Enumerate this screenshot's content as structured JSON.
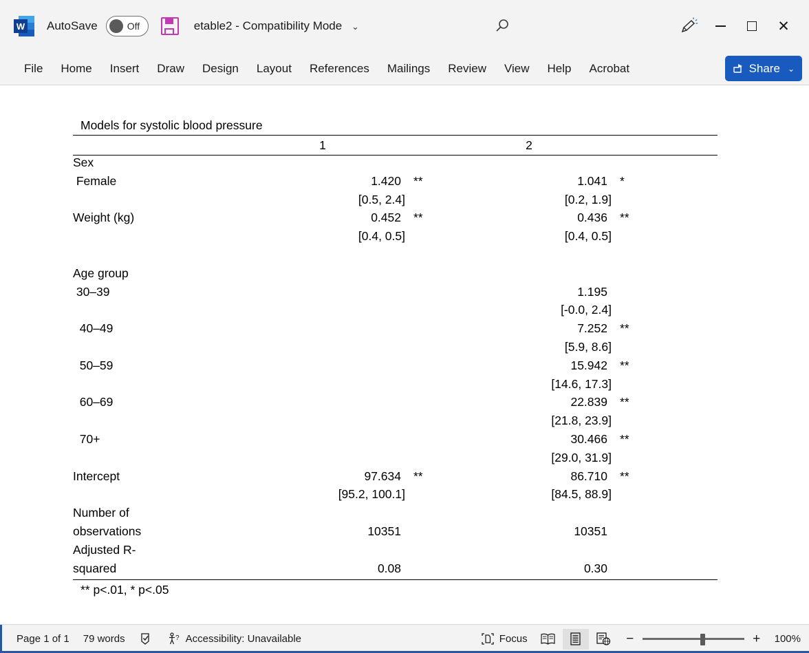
{
  "titlebar": {
    "app_icon": "word-logo-icon",
    "autosave_label": "AutoSave",
    "autosave_state": "Off",
    "save_icon": "save-icon",
    "document_name": "etable2",
    "separator": "-",
    "mode_label": "Compatibility Mode",
    "title_chevron": "⌄",
    "search_icon": "search-icon",
    "pen_icon": "ink-pen-icon",
    "minimize": "minimize-icon",
    "maximize": "maximize-icon",
    "close": "close-icon"
  },
  "ribbon": {
    "tabs": [
      {
        "label": "File"
      },
      {
        "label": "Home"
      },
      {
        "label": "Insert"
      },
      {
        "label": "Draw"
      },
      {
        "label": "Design"
      },
      {
        "label": "Layout"
      },
      {
        "label": "References"
      },
      {
        "label": "Mailings"
      },
      {
        "label": "Review"
      },
      {
        "label": "View"
      },
      {
        "label": "Help"
      },
      {
        "label": "Acrobat"
      }
    ],
    "share_label": "Share",
    "share_chevron": "⌄",
    "share_color": "#185abd"
  },
  "document": {
    "table": {
      "caption": "Models for systolic blood pressure",
      "columns": [
        "1",
        "2"
      ],
      "rows": [
        {
          "label": "Sex",
          "v1": "",
          "s1": "",
          "v2": "",
          "s2": "",
          "type": "group"
        },
        {
          "label": " Female",
          "v1": "1.420",
          "s1": "**",
          "v2": "1.041",
          "s2": "*",
          "type": "coef"
        },
        {
          "label": "",
          "v1": "[0.5,  2.4]",
          "s1": "",
          "v2": "[0.2,  1.9]",
          "s2": "",
          "type": "ci"
        },
        {
          "label": "Weight (kg)",
          "v1": "0.452",
          "s1": "**",
          "v2": "0.436",
          "s2": "**",
          "type": "coef"
        },
        {
          "label": "",
          "v1": "[0.4,  0.5]",
          "s1": "",
          "v2": "[0.4,  0.5]",
          "s2": "",
          "type": "ci"
        },
        {
          "label": "",
          "v1": "",
          "s1": "",
          "v2": "",
          "s2": "",
          "type": "blank"
        },
        {
          "label": "Age group",
          "v1": "",
          "s1": "",
          "v2": "",
          "s2": "",
          "type": "group"
        },
        {
          "label": " 30–39",
          "v1": "",
          "s1": "",
          "v2": "1.195",
          "s2": "",
          "type": "coef"
        },
        {
          "label": "",
          "v1": "",
          "s1": "",
          "v2": "[-0.0,  2.4]",
          "s2": "",
          "type": "ci"
        },
        {
          "label": "  40–49",
          "v1": "",
          "s1": "",
          "v2": "7.252",
          "s2": "**",
          "type": "coef"
        },
        {
          "label": "",
          "v1": "",
          "s1": "",
          "v2": "[5.9,  8.6]",
          "s2": "",
          "type": "ci"
        },
        {
          "label": "  50–59",
          "v1": "",
          "s1": "",
          "v2": "15.942",
          "s2": "**",
          "type": "coef"
        },
        {
          "label": "",
          "v1": "",
          "s1": "",
          "v2": "[14.6,  17.3]",
          "s2": "",
          "type": "ci"
        },
        {
          "label": "  60–69",
          "v1": "",
          "s1": "",
          "v2": "22.839",
          "s2": "**",
          "type": "coef"
        },
        {
          "label": "",
          "v1": "",
          "s1": "",
          "v2": "[21.8,  23.9]",
          "s2": "",
          "type": "ci"
        },
        {
          "label": "  70+",
          "v1": "",
          "s1": "",
          "v2": "30.466",
          "s2": "**",
          "type": "coef"
        },
        {
          "label": "",
          "v1": "",
          "s1": "",
          "v2": "[29.0,  31.9]",
          "s2": "",
          "type": "ci"
        },
        {
          "label": "Intercept",
          "v1": "97.634",
          "s1": "**",
          "v2": "86.710",
          "s2": "**",
          "type": "coef"
        },
        {
          "label": "",
          "v1": "[95.2, 100.1]",
          "s1": "",
          "v2": "[84.5,  88.9]",
          "s2": "",
          "type": "ci"
        },
        {
          "label": "Number of",
          "v1": "",
          "s1": "",
          "v2": "",
          "s2": "",
          "type": "group"
        },
        {
          "label": "observations",
          "v1": "10351",
          "s1": "",
          "v2": "10351",
          "s2": "",
          "type": "stat"
        },
        {
          "label": "Adjusted R-",
          "v1": "",
          "s1": "",
          "v2": "",
          "s2": "",
          "type": "group"
        },
        {
          "label": "squared",
          "v1": "0.08",
          "s1": "",
          "v2": "0.30",
          "s2": "",
          "type": "stat"
        }
      ],
      "footnote": "** p<.01, * p<.05"
    }
  },
  "statusbar": {
    "page_label": "Page 1 of 1",
    "word_count": "79 words",
    "proofing_icon": "proofing-check-icon",
    "accessibility_icon": "accessibility-icon",
    "accessibility_label": "Accessibility: Unavailable",
    "focus_icon": "focus-icon",
    "focus_label": "Focus",
    "view_read": "read-mode-icon",
    "view_print": "print-layout-icon",
    "view_web": "web-layout-icon",
    "zoom_out": "−",
    "zoom_in": "+",
    "zoom_level": "100%",
    "accent_color": "#2b579a"
  }
}
